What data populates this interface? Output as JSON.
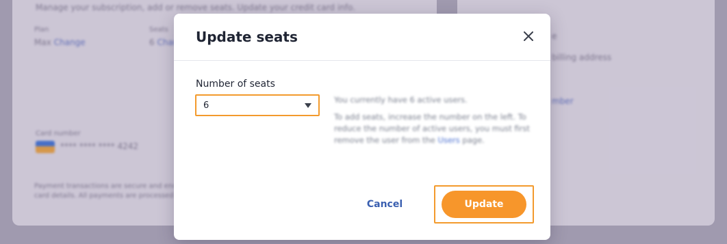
{
  "background": {
    "subtitle": "Manage your subscription, add or remove seats. Update your credit card info.",
    "plan_label": "Plan",
    "plan_value": "Max",
    "plan_change": "Change",
    "seats_label": "Seats",
    "seats_value": "6",
    "seats_change": "Change",
    "card_label": "Card number",
    "card_value": "**** **** **** 4242",
    "payment_note_line1": "Payment transactions are secure and encrypted. We never store your",
    "payment_note_line2": "card details. All payments are processed",
    "right_line1": "e",
    "right_line2": "billing address",
    "right_line3": "mber"
  },
  "modal": {
    "title": "Update seats",
    "field_label": "Number of seats",
    "selected_value": "6",
    "info_line1": "You currently have 6 active users.",
    "info_line2": "To add seats, increase the number on the left. To reduce the number of active users, you must first remove the user from the",
    "info_link": "Users",
    "info_line3": "page.",
    "cancel_label": "Cancel",
    "update_label": "Update"
  },
  "colors": {
    "accent": "#f7962b",
    "highlight_border": "#f39a2c",
    "link": "#3a5fb0",
    "title": "#1f2433"
  },
  "icons": {
    "close": "close-icon",
    "dropdown": "chevron-down-icon",
    "card": "credit-card-icon"
  }
}
